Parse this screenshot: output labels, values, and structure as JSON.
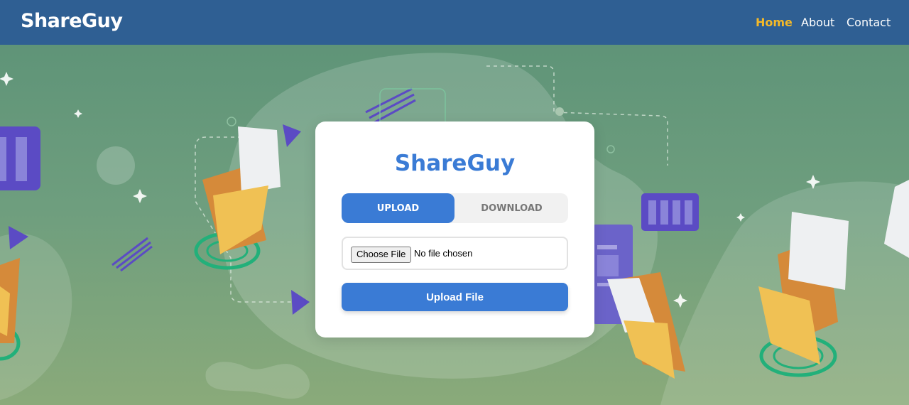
{
  "navbar": {
    "brand": "ShareGuy",
    "links": [
      {
        "label": "Home",
        "active": true
      },
      {
        "label": "About",
        "active": false
      },
      {
        "label": "Contact",
        "active": false
      }
    ]
  },
  "card": {
    "title": "ShareGuy",
    "tabs": [
      {
        "label": "UPLOAD",
        "active": true
      },
      {
        "label": "DOWNLOAD",
        "active": false
      }
    ],
    "file_input": {
      "button_label": "Choose File",
      "status_text": "No file chosen"
    },
    "submit_label": "Upload File"
  },
  "colors": {
    "navbar_bg": "#2f5f93",
    "accent": "#3a7bd5",
    "active_link": "#f4b928"
  }
}
